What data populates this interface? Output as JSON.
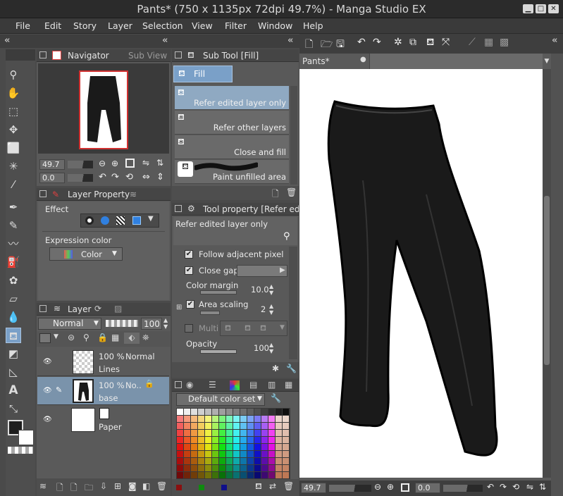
{
  "window": {
    "title": "Pants* (750 x 1135px 72dpi 49.7%)  - Manga Studio EX"
  },
  "menu": [
    "File",
    "Edit",
    "Story",
    "Layer",
    "Selection",
    "View",
    "Filter",
    "Window",
    "Help"
  ],
  "navigator": {
    "tabs": [
      "Navigator",
      "Sub View"
    ],
    "zoom": "49.7",
    "angle": "0.0"
  },
  "layer_property": {
    "tab": "Layer Property",
    "effect_label": "Effect",
    "expression_label": "Expression color",
    "expression_value": "Color"
  },
  "layer_panel": {
    "tab": "Layer",
    "blend_mode": "Normal",
    "opacity": "100",
    "layers": [
      {
        "opacity": "100 %",
        "mode": "Normal",
        "name": "Lines"
      },
      {
        "opacity": "100 %",
        "mode": "No..",
        "name": "base"
      },
      {
        "opacity": "",
        "mode": "",
        "name": "Paper"
      }
    ]
  },
  "sub_tool": {
    "tab": "Sub Tool [Fill]",
    "group": "Fill",
    "items": [
      "Refer edited layer only",
      "Refer other layers",
      "Close and fill",
      "Paint unfilled area"
    ]
  },
  "tool_property": {
    "tab": "Tool property [Refer edit",
    "preset": "Refer edited layer only",
    "follow_adjacent": "Follow adjacent pixel",
    "close_gap": "Close gap",
    "color_margin_label": "Color margin",
    "color_margin": "10.0",
    "area_scaling_label": "Area scaling",
    "area_scaling": "2",
    "multi_label": "Multi",
    "opacity_label": "Opacity",
    "opacity": "100"
  },
  "color_set": {
    "name": "Default color set"
  },
  "canvas": {
    "tab": "Pants*",
    "zoom": "49.7",
    "angle": "0.0"
  },
  "colors": {
    "accent": "#7aa0c8",
    "panel": "#595959",
    "dark": "#3a3a3a"
  }
}
